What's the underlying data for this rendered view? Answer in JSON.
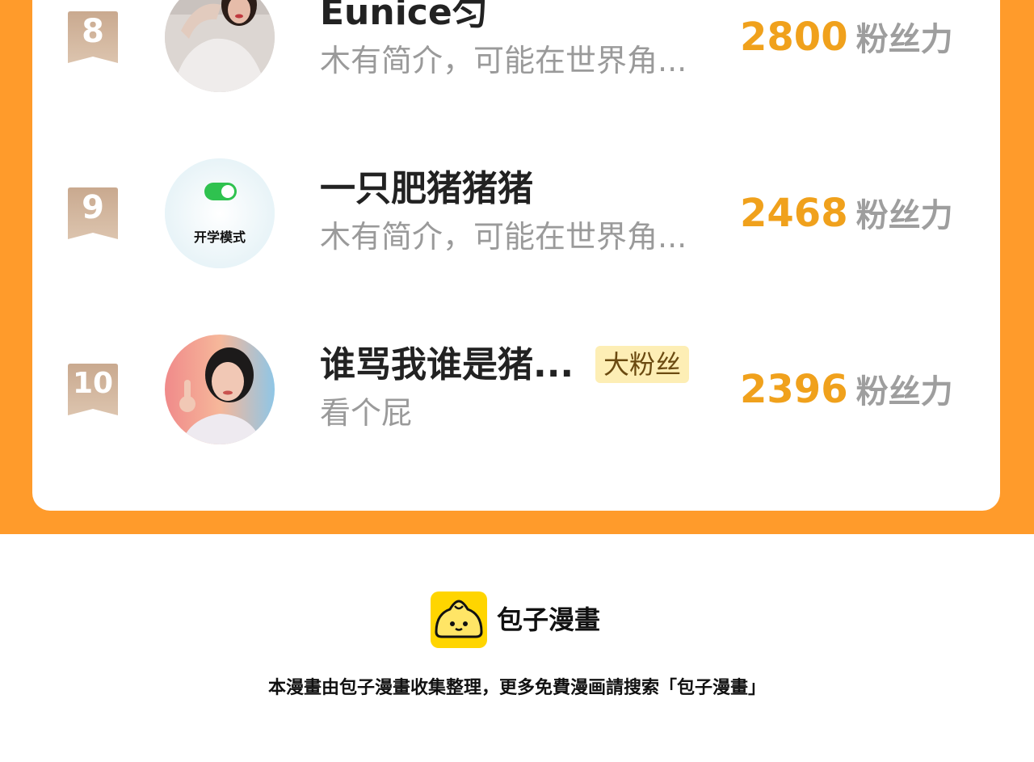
{
  "ranking": [
    {
      "rank": "8",
      "name": "Eunice匀",
      "description": "木有简介，可能在世界角...",
      "score": "2800",
      "score_unit": "粉丝力",
      "avatar_icon": "photo-avatar-woman"
    },
    {
      "rank": "9",
      "name": "一只肥猪猪猪",
      "description": "木有简介，可能在世界角...",
      "score": "2468",
      "score_unit": "粉丝力",
      "avatar_icon": "toggle-switch-avatar",
      "avatar_text": "开学模式"
    },
    {
      "rank": "10",
      "name": "谁骂我谁是猪...",
      "tag": "大粉丝",
      "description": "看个屁",
      "score": "2396",
      "score_unit": "粉丝力",
      "avatar_icon": "photo-avatar-woman-short-hair"
    }
  ],
  "footer": {
    "brand": "包子漫畫",
    "note": "本漫畫由包子漫畫收集整理，更多免費漫画請搜索「包子漫畫」",
    "logo_icon": "bun-logo-icon"
  },
  "colors": {
    "orange_background": "#ff9b2b",
    "score": "#f0a11c",
    "badge": "#c8a88c",
    "tag_bg": "#fdeeb5"
  }
}
